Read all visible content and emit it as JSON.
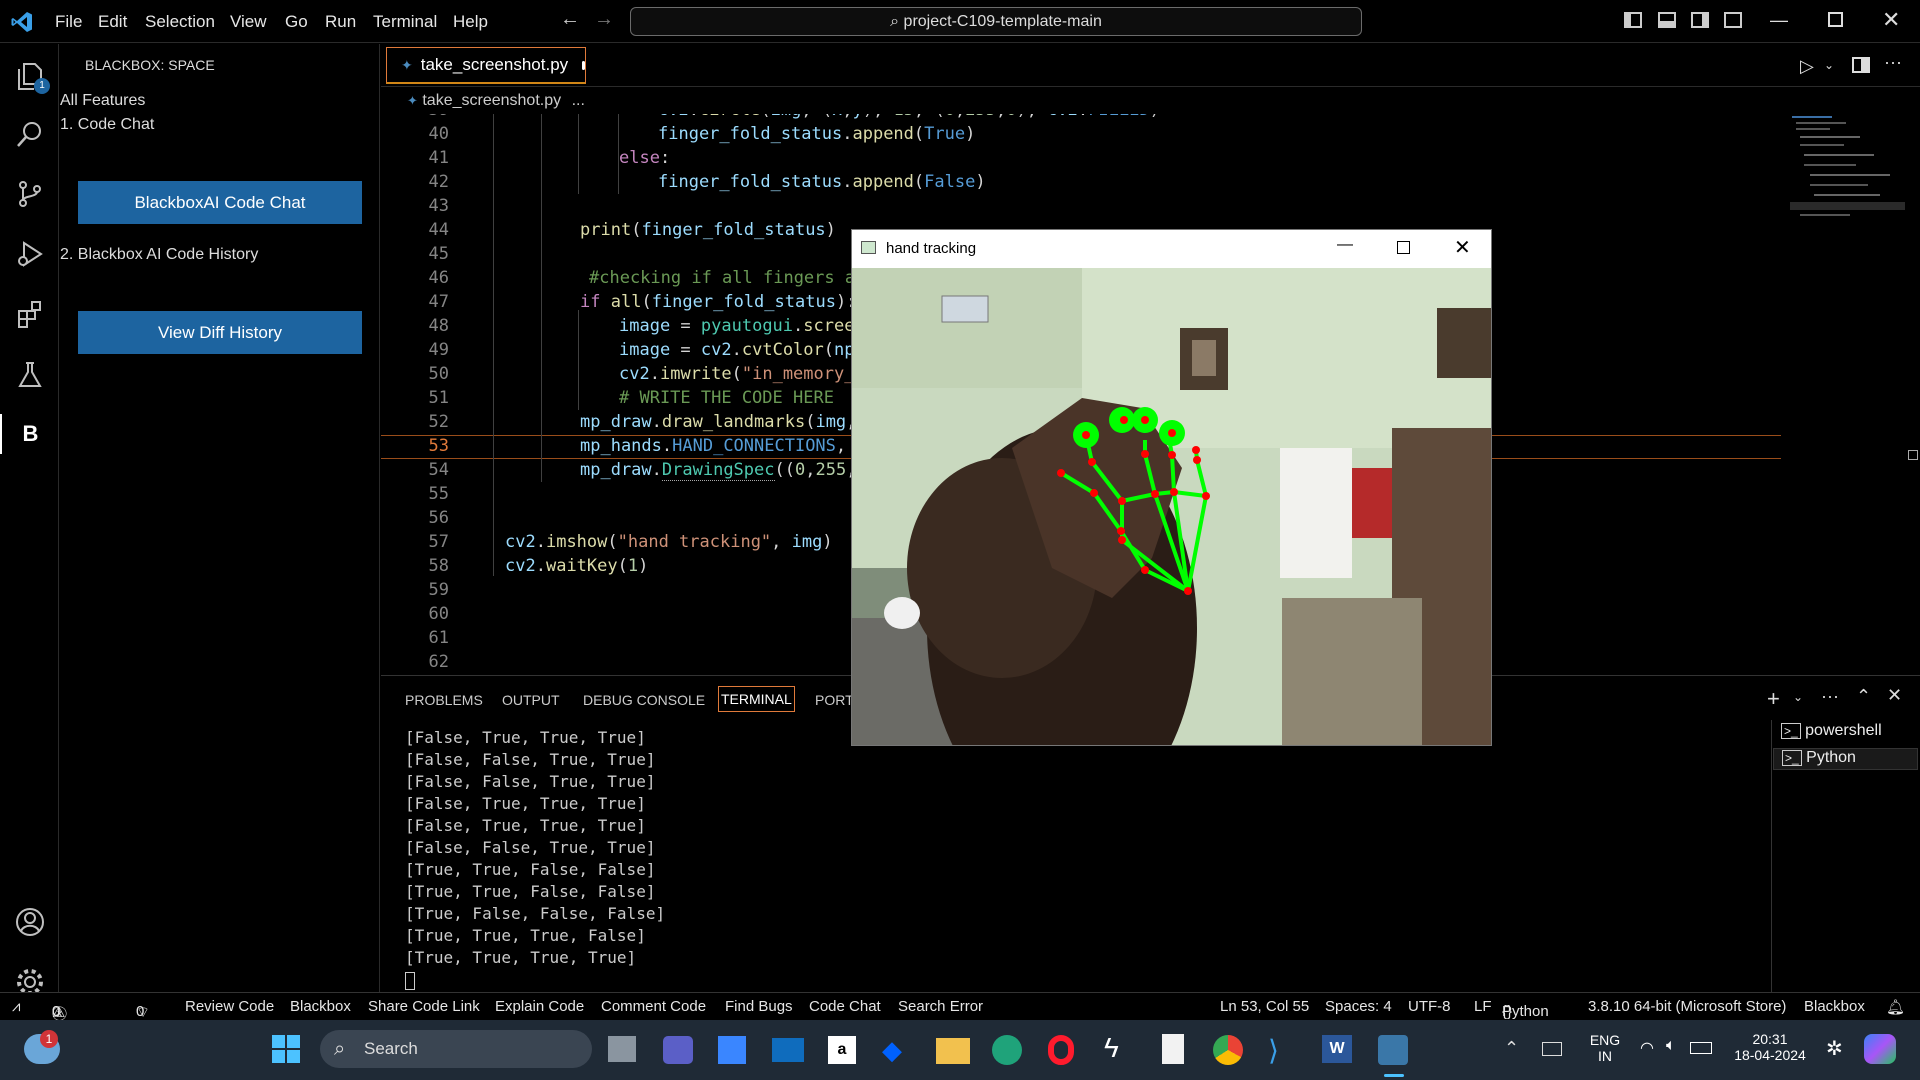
{
  "titlebar": {
    "menus": [
      "File",
      "Edit",
      "Selection",
      "View",
      "Go",
      "Run",
      "Terminal",
      "Help"
    ],
    "command_center": "project-C109-template-main"
  },
  "activity": {
    "explorer_badge": "1",
    "blackbox_letter": "B"
  },
  "sidebar": {
    "title": "BLACKBOX: SPACE",
    "all_features": "All Features",
    "code_chat": "1. Code Chat",
    "code_chat_button": "BlackboxAI Code Chat",
    "history": "2. Blackbox AI Code History",
    "history_button": "View Diff History"
  },
  "editor": {
    "tab_label": "take_screenshot.py",
    "breadcrumb_file": "take_screenshot.py",
    "breadcrumb_more": "...",
    "line_numbers": [
      "40",
      "41",
      "42",
      "43",
      "44",
      "45",
      "46",
      "47",
      "48",
      "49",
      "50",
      "51",
      "52",
      "53",
      "54",
      "55",
      "56",
      "57",
      "58",
      "59",
      "60",
      "61",
      "62"
    ],
    "current_line": "53"
  },
  "panel": {
    "tabs": [
      "PROBLEMS",
      "OUTPUT",
      "DEBUG CONSOLE",
      "TERMINAL",
      "PORTS"
    ],
    "active_tab": "TERMINAL",
    "terminals": [
      "powershell",
      "Python"
    ],
    "output": [
      "[False, True, True, True]",
      "[False, False, True, True]",
      "[False, False, True, True]",
      "[False, True, True, True]",
      "[False, True, True, True]",
      "[False, False, True, True]",
      "[True, True, False, False]",
      "[True, True, False, False]",
      "[True, False, False, False]",
      "[True, True, True, False]",
      "[True, True, True, True]"
    ]
  },
  "window": {
    "title": "hand tracking"
  },
  "status": {
    "errors": "0",
    "warnings": "0",
    "ports": "0",
    "items": [
      "Review Code",
      "Blackbox",
      "Share Code Link",
      "Explain Code",
      "Comment Code",
      "Find Bugs",
      "Code Chat",
      "Search Error"
    ],
    "position": "Ln 53, Col 55",
    "spaces": "Spaces: 4",
    "encoding": "UTF-8",
    "eol": "LF",
    "language": "Python",
    "interpreter": "3.8.10 64-bit (Microsoft Store)",
    "blackbox": "Blackbox"
  },
  "taskbar": {
    "search_placeholder": "Search",
    "weather_badge": "1",
    "lang1": "ENG",
    "lang2": "IN",
    "time": "20:31",
    "date": "18-04-2024"
  },
  "colors": {
    "accent_blue": "#1d64a0",
    "modified_tab": "#e07a3a",
    "tracking_green": "#00ff00",
    "landmark_red": "#ff0000"
  }
}
